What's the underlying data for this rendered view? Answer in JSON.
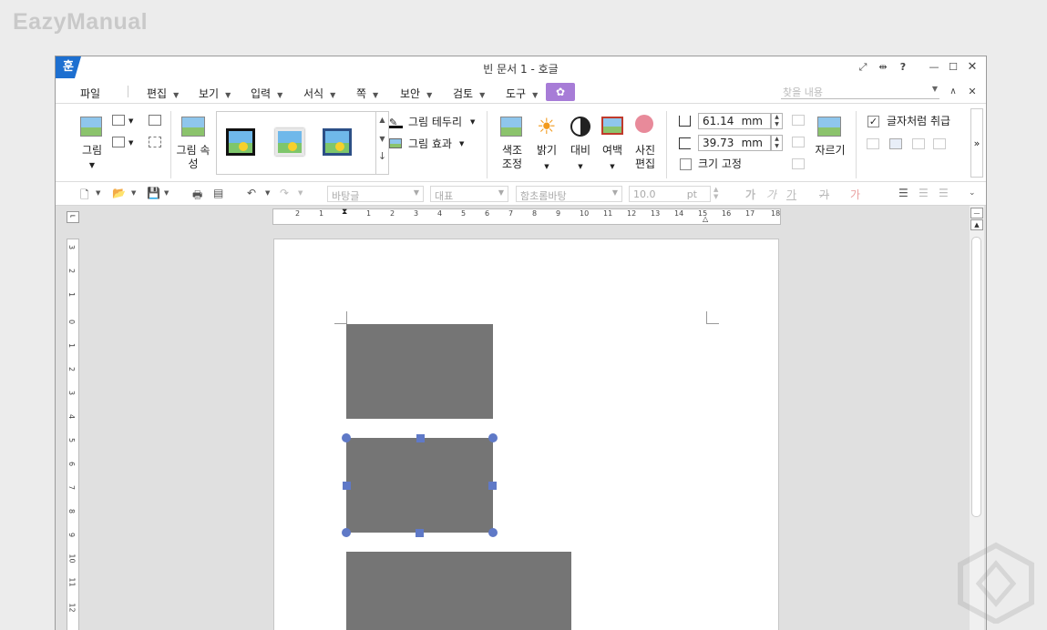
{
  "watermark": {
    "brand": "EazyManual"
  },
  "window": {
    "title": "빈 문서 1 - 호글",
    "app_icon_char": "훈"
  },
  "menubar": {
    "file": "파일",
    "items": [
      "편집",
      "보기",
      "입력",
      "서식",
      "쪽",
      "보안",
      "검토",
      "도구"
    ],
    "find_placeholder": "찾을 내용"
  },
  "ribbon": {
    "picture_label": "그림",
    "picture_props_label": "그림 속성",
    "border_label": "그림 테두리",
    "effect_label": "그림 효과",
    "color_adjust_label": "색조 조정",
    "brightness_label": "밝기",
    "contrast_label": "대비",
    "margin_label": "여백",
    "photo_edit_label": "사진 편집",
    "width_value": "61.14",
    "height_value": "39.73",
    "unit": "mm",
    "lock_size_label": "크기 고정",
    "crop_label": "자르기",
    "treat_as_char_label": "글자처럼 취급",
    "expand": "»"
  },
  "toolbar2": {
    "style_value": "바탕글",
    "lang_value": "대표",
    "font_value": "함초롬바탕",
    "size_value": "10.0",
    "size_unit": "pt"
  },
  "ruler": {
    "h_numbers": [
      "2",
      "1",
      "1",
      "2",
      "3",
      "4",
      "5",
      "6",
      "7",
      "8",
      "9",
      "10",
      "11",
      "12",
      "13",
      "14",
      "15",
      "16",
      "17",
      "18"
    ],
    "v_numbers": [
      "3",
      "2",
      "1",
      "0",
      "1",
      "2",
      "3",
      "4",
      "5",
      "6",
      "7",
      "8",
      "9",
      "10",
      "11",
      "12"
    ]
  },
  "document": {
    "images": [
      {
        "name": "image-1",
        "selected": false
      },
      {
        "name": "image-2",
        "selected": true
      },
      {
        "name": "image-3",
        "selected": false
      }
    ]
  },
  "colors": {
    "accent": "#1d6fd0",
    "image_fill": "#757575",
    "handle": "#5f79c7",
    "mint_button": "#a77cd7"
  }
}
